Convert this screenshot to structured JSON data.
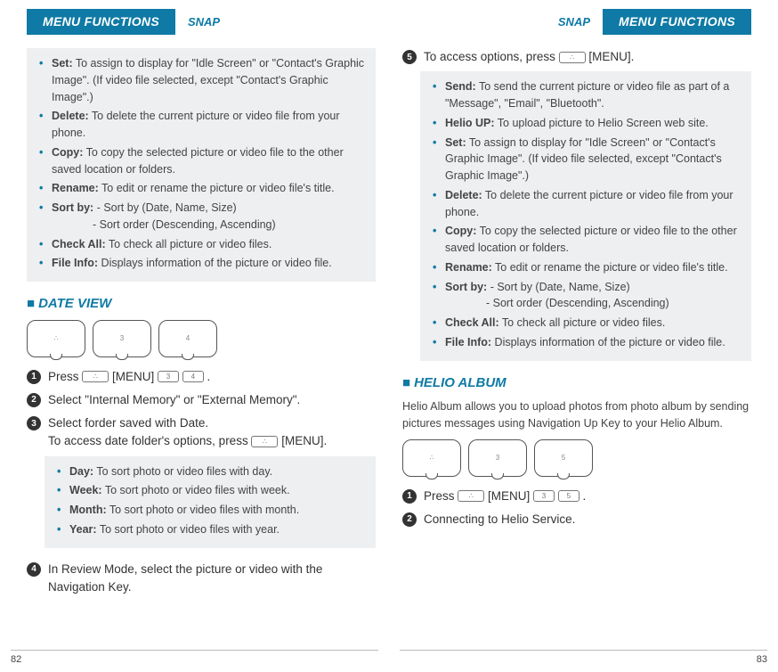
{
  "header": {
    "menu_label": "MENU FUNCTIONS",
    "snap_label": "SNAP"
  },
  "left": {
    "box1": {
      "set_b": "Set:",
      "set_t": " To assign to display for \"Idle Screen\" or \"Contact's Graphic Image\". (If video file selected, except \"Contact's Graphic Image\".)",
      "del_b": "Delete:",
      "del_t": " To delete the current picture or video file from your phone.",
      "copy_b": "Copy:",
      "copy_t": " To copy the selected picture or video file to the other saved location or folders.",
      "ren_b": "Rename:",
      "ren_t": " To edit or rename the picture or video file's title.",
      "sort_b": "Sort by:",
      "sort_t": " - Sort by (Date, Name, Size)",
      "sort_t2": "- Sort order (Descending, Ascending)",
      "check_b": "Check All:",
      "check_t": " To check all picture or video files.",
      "info_b": "File Info:",
      "info_t": " Displays information of the picture or video file."
    },
    "date_title": "DATE VIEW",
    "step1": "Press ",
    "step1_menu": " [MENU] ",
    "step1_end": " .",
    "step2": "Select \"Internal Memory\" or \"External Memory\".",
    "step3a": "Select forder saved with Date.",
    "step3b": "To access date folder's options, press ",
    "step3c": " [MENU].",
    "box2": {
      "day_b": "Day:",
      "day_t": " To sort photo or video files with day.",
      "week_b": "Week:",
      "week_t": " To sort photo or video files with week.",
      "month_b": "Month:",
      "month_t": " To sort photo or video files with month.",
      "year_b": "Year:",
      "year_t": " To sort photo or video files with year."
    },
    "step4": "In Review Mode, select the picture or video with the Navigation Key.",
    "pagenum": "82",
    "key3": "3",
    "key4": "4"
  },
  "right": {
    "step5a": "To access options, press ",
    "step5b": " [MENU].",
    "box": {
      "send_b": "Send:",
      "send_t": " To send the current picture or video file as part of a \"Message\", \"Email\", \"Bluetooth\".",
      "helio_b": "Helio UP:",
      "helio_t": " To upload picture to Helio Screen web site.",
      "set_b": "Set:",
      "set_t": " To assign to display for \"Idle Screen\" or \"Contact's Graphic Image\". (If video file selected, except \"Contact's Graphic Image\".)",
      "del_b": "Delete:",
      "del_t": " To delete the current picture or video file from your phone.",
      "copy_b": "Copy:",
      "copy_t": " To copy the selected picture or video file to the other saved location or folders.",
      "ren_b": "Rename:",
      "ren_t": " To edit or rename the picture or video file's title.",
      "sort_b": "Sort by:",
      "sort_t": " - Sort by (Date, Name, Size)",
      "sort_t2": "- Sort order (Descending, Ascending)",
      "check_b": "Check All:",
      "check_t": " To check all picture or video files.",
      "info_b": "File Info:",
      "info_t": " Displays information of the picture or video file."
    },
    "helio_title": "HELIO ALBUM",
    "helio_intro": "Helio Album allows you to upload photos from photo album by sending pictures messages using Navigation Up Key to your Helio Album.",
    "step1": "Press ",
    "step1_menu": " [MENU] ",
    "step1_end": " .",
    "step2": "Connecting to Helio Service.",
    "pagenum": "83",
    "key3": "3",
    "key5": "5"
  }
}
